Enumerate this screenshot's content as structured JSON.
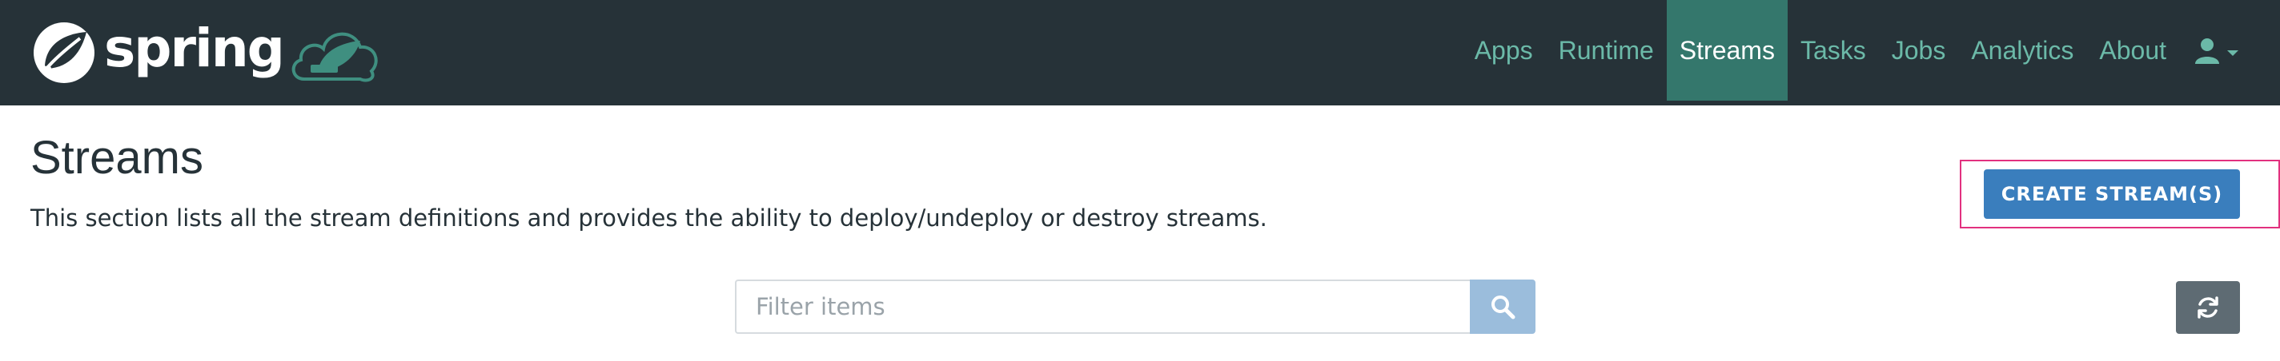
{
  "brand": {
    "name": "spring"
  },
  "nav": {
    "items": [
      {
        "label": "Apps",
        "active": false
      },
      {
        "label": "Runtime",
        "active": false
      },
      {
        "label": "Streams",
        "active": true
      },
      {
        "label": "Tasks",
        "active": false
      },
      {
        "label": "Jobs",
        "active": false
      },
      {
        "label": "Analytics",
        "active": false
      },
      {
        "label": "About",
        "active": false
      }
    ],
    "user_icon": "user-icon"
  },
  "page": {
    "title": "Streams",
    "description": "This section lists all the stream definitions and provides the ability to deploy/undeploy or destroy streams."
  },
  "actions": {
    "create_label": "CREATE STREAM(S)"
  },
  "filter": {
    "placeholder": "Filter items",
    "value": "",
    "search_icon": "search-icon"
  },
  "refresh": {
    "icon": "refresh-icon"
  },
  "colors": {
    "navbar_bg": "#263238",
    "nav_link": "#6bb9a8",
    "nav_active_bg": "#34776c",
    "primary_button": "#3a7ebd",
    "highlight": "#e2317f",
    "search_button": "#9bbddc",
    "refresh_button": "#5e6b73"
  }
}
